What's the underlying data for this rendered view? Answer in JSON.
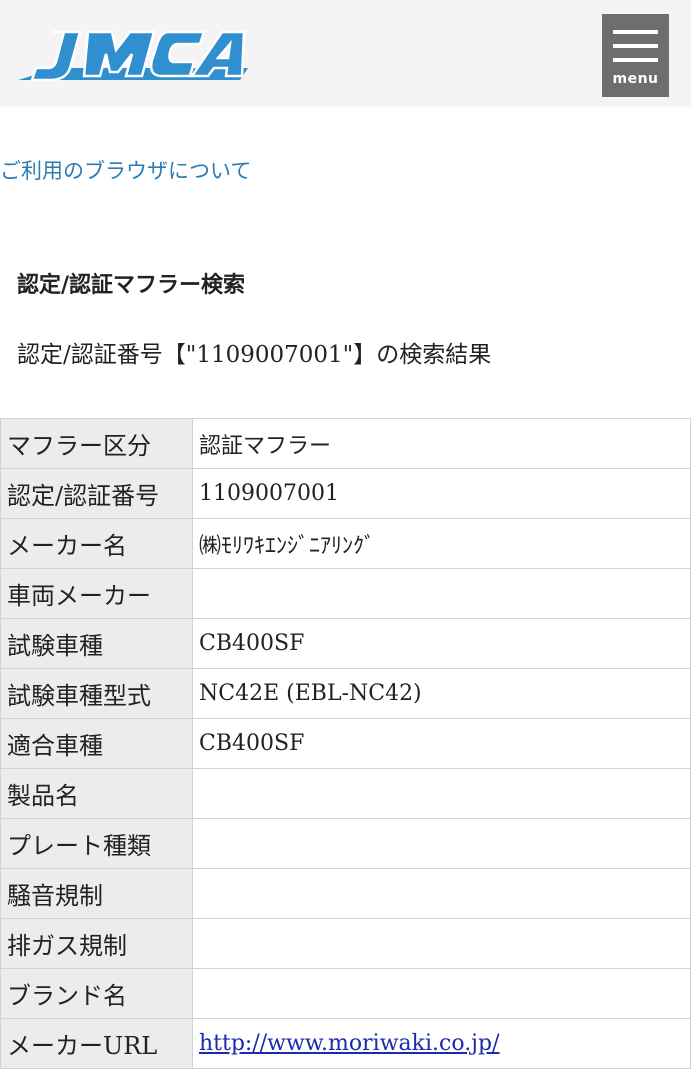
{
  "header": {
    "logo_text": "JMCA",
    "brand_color": "#2f8fcf",
    "menu_label": "menu"
  },
  "browser_link": "ご利用のブラウザについて",
  "section_title": "認定/認証マフラー検索",
  "result_caption": "認定/認証番号【\"1109007001\"】の検索結果",
  "rows": [
    {
      "label": "マフラー区分",
      "value": "認証マフラー"
    },
    {
      "label": "認定/認証番号",
      "value": "1109007001"
    },
    {
      "label": "メーカー名",
      "value": "㈱ﾓﾘﾜｷｴﾝｼﾞﾆｱﾘﾝｸﾞ"
    },
    {
      "label": "車両メーカー",
      "value": ""
    },
    {
      "label": "試験車種",
      "value": "CB400SF"
    },
    {
      "label": "試験車種型式",
      "value": "NC42E (EBL-NC42)"
    },
    {
      "label": "適合車種",
      "value": "CB400SF"
    },
    {
      "label": "製品名",
      "value": ""
    },
    {
      "label": "プレート種類",
      "value": ""
    },
    {
      "label": "騒音規制",
      "value": ""
    },
    {
      "label": "排ガス規制",
      "value": ""
    },
    {
      "label": "ブランド名",
      "value": ""
    },
    {
      "label": "メーカーURL",
      "value": "http://www.moriwaki.co.jp/"
    }
  ]
}
